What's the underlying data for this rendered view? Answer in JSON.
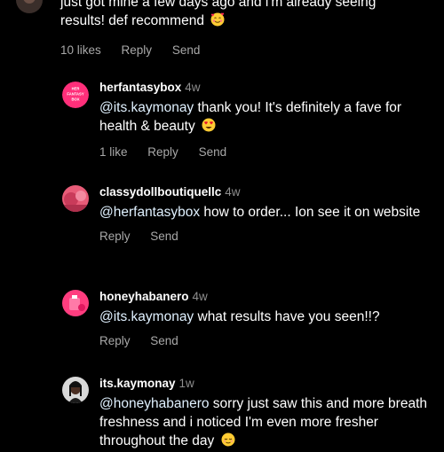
{
  "comments": [
    {
      "text_lines": [
        "just got mine a few days ago and i'm already seeing",
        "results! def recommend"
      ],
      "emoji": "smiling-face-with-hearts",
      "likes": "10 likes",
      "reply": "Reply",
      "send": "Send"
    },
    {
      "username": "herfantasybox",
      "time": "4w",
      "avatar_text": [
        "HER",
        "FANTASY",
        "BOX"
      ],
      "mention": "@its.kaymonay",
      "text": " thank you! It's definitely a fave for health & beauty",
      "emoji": "heart-eyes",
      "likes": "1 like",
      "reply": "Reply",
      "send": "Send"
    },
    {
      "username": "classydollboutiquellc",
      "time": "4w",
      "mention": "@herfantasybox",
      "text": " how to order... Ion see it on website",
      "reply": "Reply",
      "send": "Send"
    },
    {
      "username": "honeyhabanero",
      "time": "4w",
      "mention": "@its.kaymonay",
      "text": " what results have you seen!!?",
      "reply": "Reply",
      "send": "Send"
    },
    {
      "username": "its.kaymonay",
      "time": "1w",
      "mention": "@honeyhabanero",
      "text": " sorry just saw this and more breath freshness and i noticed I'm even more fresher throughout the day",
      "emoji": "relieved-face"
    }
  ],
  "colors": {
    "background": "#000000",
    "text": "#ffffff",
    "secondary": "#8e8e8e",
    "mention": "#e0f1ff",
    "brand_pink": "#ff2f7a"
  }
}
